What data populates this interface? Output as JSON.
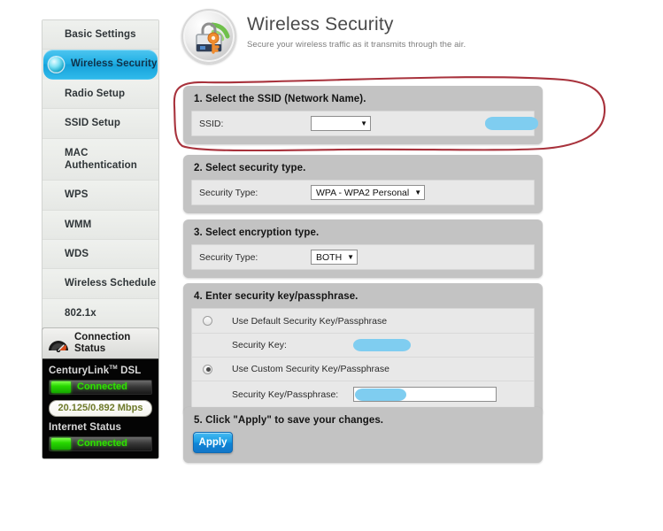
{
  "sidebar": {
    "items": [
      {
        "label": "Basic Settings",
        "selected": false,
        "icon": ""
      },
      {
        "label": "Wireless Security",
        "selected": true,
        "icon": "orb-icon"
      },
      {
        "label": "Radio Setup",
        "selected": false,
        "icon": ""
      },
      {
        "label": "SSID Setup",
        "selected": false,
        "icon": ""
      },
      {
        "label": "MAC Authentication",
        "selected": false,
        "icon": ""
      },
      {
        "label": "WPS",
        "selected": false,
        "icon": ""
      },
      {
        "label": "WMM",
        "selected": false,
        "icon": ""
      },
      {
        "label": "WDS",
        "selected": false,
        "icon": ""
      },
      {
        "label": "Wireless Schedule",
        "selected": false,
        "icon": ""
      },
      {
        "label": "802.1x",
        "selected": false,
        "icon": ""
      }
    ]
  },
  "connection_status": {
    "title_line1": "Connection",
    "title_line2": "Status",
    "icon": "speedometer-icon",
    "dsl_label": "CenturyLink",
    "dsl_trademark": "TM",
    "dsl_suffix": "DSL",
    "dsl_state": "Connected",
    "speed": "20.125/0.892 Mbps",
    "internet_label": "Internet Status",
    "internet_state": "Connected",
    "led_color": "#28d800",
    "state_text_color": "#2ee000",
    "speed_text_color": "#6e7a2a"
  },
  "header": {
    "icon": "wireless-lock-key-icon",
    "title": "Wireless Security",
    "subtitle": "Secure your wireless traffic as it transmits through the air."
  },
  "sections": {
    "ssid": {
      "title": "1. Select the SSID (Network Name).",
      "field_label": "SSID:",
      "value": "",
      "redacted": true,
      "caret": "▼"
    },
    "security_type": {
      "title": "2. Select security type.",
      "field_label": "Security Type:",
      "value": "WPA - WPA2 Personal",
      "caret": "▼"
    },
    "encryption_type": {
      "title": "3. Select encryption type.",
      "field_label": "Security Type:",
      "value": "BOTH",
      "caret": "▼"
    },
    "security_key": {
      "title": "4. Enter security key/passphrase.",
      "option_default_label": "Use Default Security Key/Passphrase",
      "option_default_selected": false,
      "default_key_label": "Security Key:",
      "default_key_value": "",
      "default_key_redacted": true,
      "option_custom_label": "Use Custom Security Key/Passphrase",
      "option_custom_selected": true,
      "custom_key_label": "Security Key/Passphrase:",
      "custom_key_value": "",
      "custom_key_redacted": true
    },
    "apply": {
      "title": "5. Click \"Apply\" to save your changes.",
      "button_label": "Apply"
    }
  },
  "annotation": {
    "type": "hand-drawn-ellipse",
    "color": "#a8323c",
    "target": "ssid-section"
  },
  "colors": {
    "panel_bg": "#c3c3c3",
    "inner_bg": "#e8e8e8",
    "selected_nav": "#1eaee4",
    "redaction": "#7fcdf0",
    "apply_button": "#1c9de4"
  }
}
